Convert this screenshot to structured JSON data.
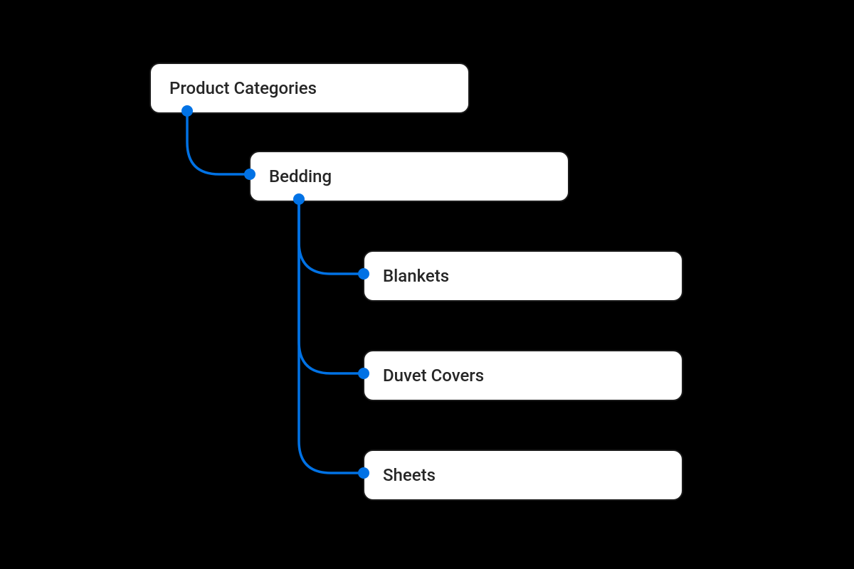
{
  "diagram": {
    "root": {
      "label": "Product Categories",
      "children": [
        {
          "label": "Bedding",
          "children": [
            {
              "label": "Blankets"
            },
            {
              "label": "Duvet Covers"
            },
            {
              "label": "Sheets"
            }
          ]
        }
      ]
    }
  },
  "colors": {
    "connector": "#0172E5",
    "node_bg": "#ffffff",
    "node_border": "#1a1a1a",
    "page_bg": "#000000"
  }
}
